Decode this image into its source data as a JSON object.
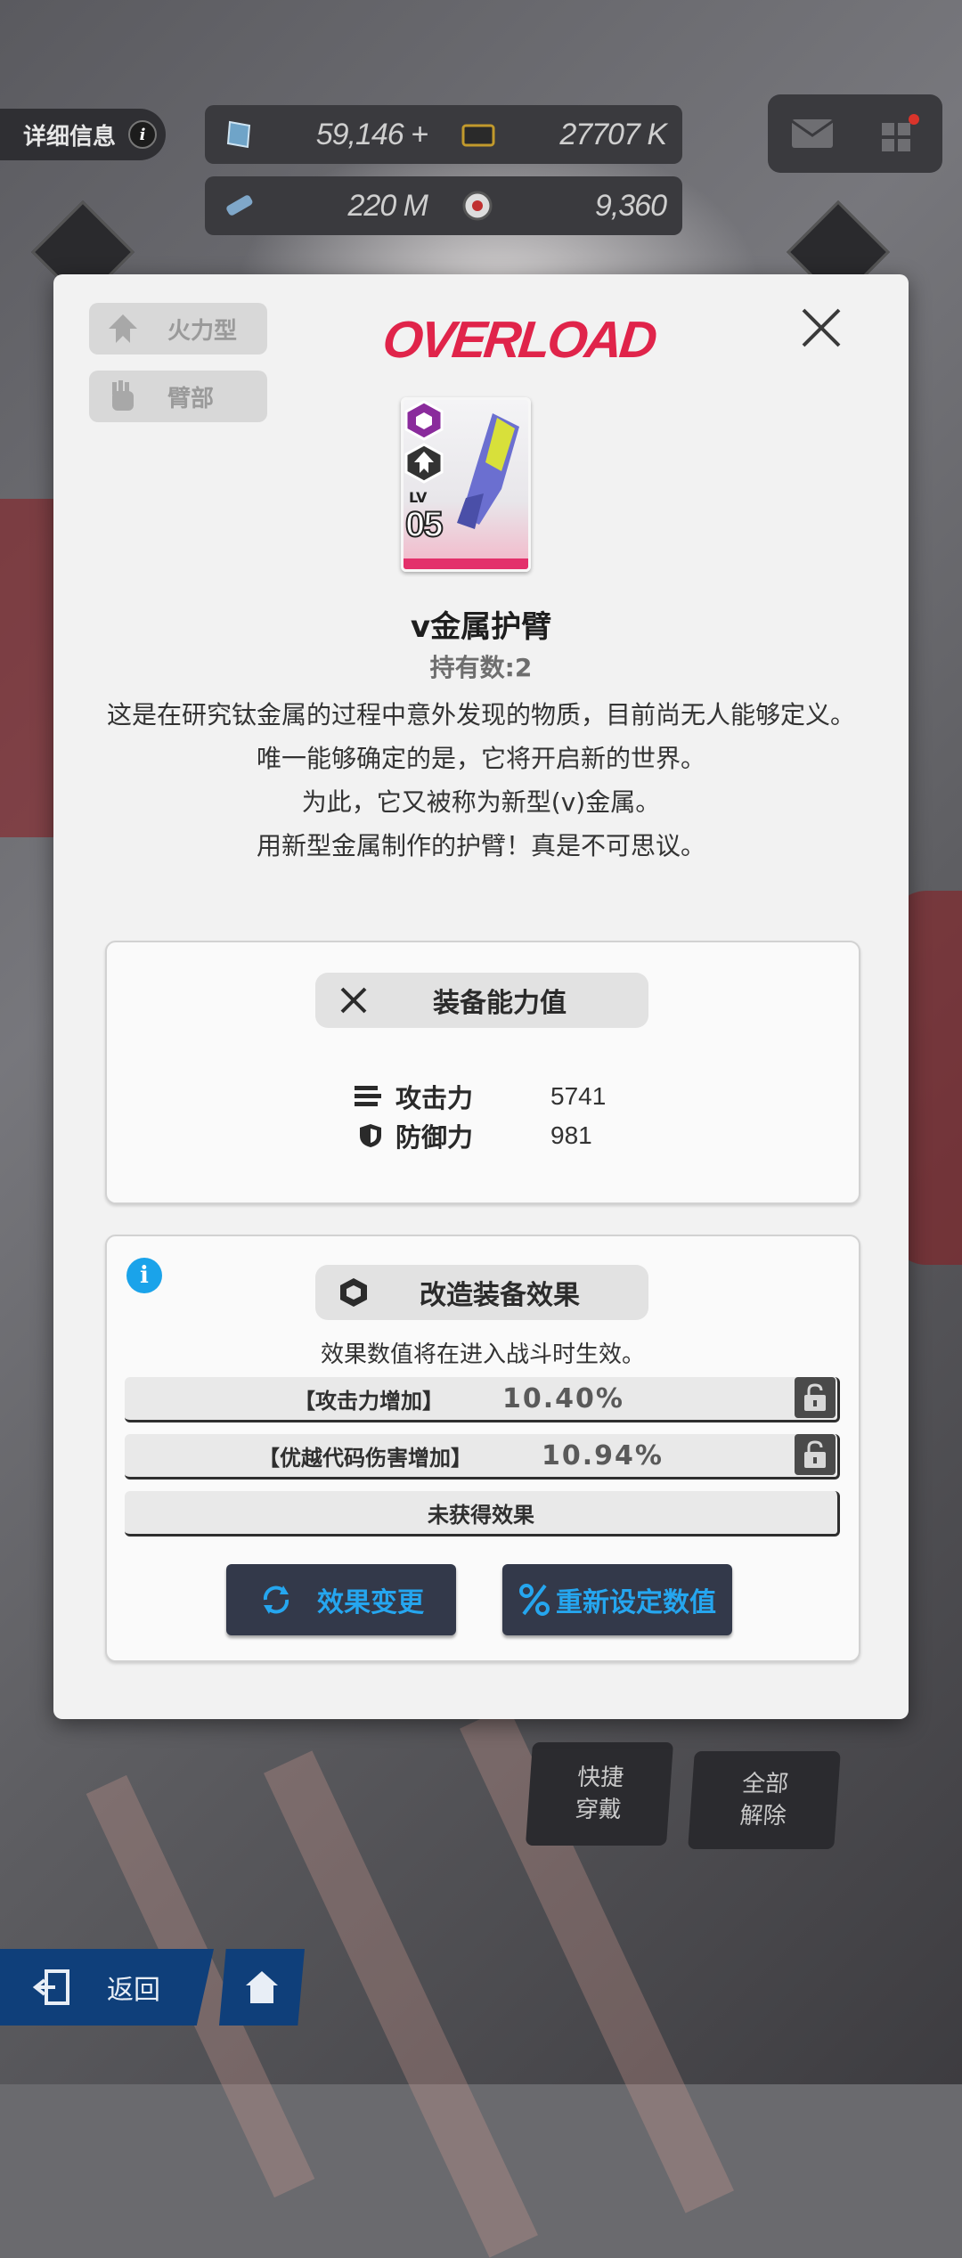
{
  "hud": {
    "detail_label": "详细信息",
    "resources": [
      {
        "name": "gem",
        "value": "59,146 +",
        "color": "#7fb0d0"
      },
      {
        "name": "credit-card",
        "value": "27707 K",
        "color": "#b8902a"
      },
      {
        "name": "battery",
        "value": "220 M",
        "color": "#7fa7c9"
      },
      {
        "name": "core",
        "value": "9,360",
        "color": "#c03030"
      }
    ]
  },
  "modal": {
    "tags": [
      {
        "label": "火力型",
        "icon": "firepower-icon"
      },
      {
        "label": "臂部",
        "icon": "arm-icon"
      }
    ],
    "logo_text": "OVERLOAD",
    "card": {
      "lv_label": "LV",
      "lv_value": "05"
    },
    "item_name": "v金属护臂",
    "holding": "持有数:2",
    "description": [
      "这是在研究钛金属的过程中意外发现的物质，目前尚无人能够定义。",
      "唯一能够确定的是，它将开启新的世界。",
      "为此，它又被称为新型(v)金属。",
      "用新型金属制作的护臂！真是不可思议。"
    ],
    "stats_panel": {
      "title": "装备能力值",
      "stats": [
        {
          "label": "攻击力",
          "value": "5741"
        },
        {
          "label": "防御力",
          "value": "981"
        }
      ]
    },
    "effects_panel": {
      "title": "改造装备效果",
      "note": "效果数值将在进入战斗时生效。",
      "effects": [
        {
          "label": "【攻击力增加】",
          "value": "10.40%"
        },
        {
          "label": "【优越代码伤害增加】",
          "value": "10.94%"
        }
      ],
      "empty_label": "未获得效果",
      "change_button": "效果变更",
      "reset_button": "重新设定数值"
    }
  },
  "bottom": {
    "quick_equip": "快捷\n穿戴",
    "unequip_all": "全部\n解除",
    "back_label": "返回"
  },
  "colors": {
    "accent_blue": "#25a6ef",
    "logo_red": "#e0244a",
    "rarity_pink": "#e3306b"
  }
}
